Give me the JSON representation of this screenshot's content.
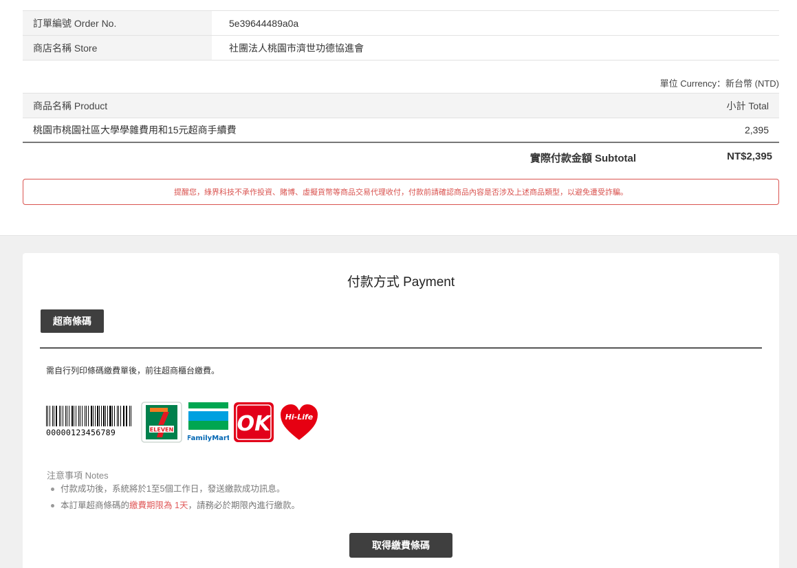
{
  "order": {
    "rows": [
      {
        "label": "訂單編號 Order No.",
        "value": "5e39644489a0a"
      },
      {
        "label": "商店名稱 Store",
        "value": "社團法人桃園市濟世功德協進會"
      }
    ]
  },
  "currency_text": "單位 Currency：新台幣 (NTD)",
  "products": {
    "header_product": "商品名稱 Product",
    "header_total": "小計 Total",
    "items": [
      {
        "name": "桃園市桃園社區大學學雜費用和15元超商手續費",
        "total": "2,395"
      }
    ]
  },
  "subtotal": {
    "label": "實際付款金額 Subtotal",
    "value": "NT$2,395"
  },
  "warning_text": "提醒您，綠界科技不承作投資、賭博、虛擬貨幣等商品交易代理收付，付款前請確認商品內容是否涉及上述商品類型，以避免遭受詐騙。",
  "payment": {
    "title": "付款方式 Payment",
    "tab_label": "超商條碼",
    "instruction": "需自行列印條碼繳費單後，前往超商櫃台繳費。",
    "barcode_number": "00000123456789",
    "logos": [
      "7-ELEVEN",
      "FamilyMart",
      "OK",
      "Hi-Life"
    ],
    "notes_title": "注意事項 Notes",
    "note1": "付款成功後，系統將於1至5個工作日，發送繳款成功訊息。",
    "note2_prefix": "本訂單超商條碼的",
    "note2_highlight": "繳費期限為 1天",
    "note2_suffix": "，請務必於期限內進行繳款。",
    "button_label": "取得繳費條碼"
  },
  "colors": {
    "warning": "#d9534f",
    "dark_button": "#3f3f3f",
    "highlight": "#e05a5a"
  }
}
